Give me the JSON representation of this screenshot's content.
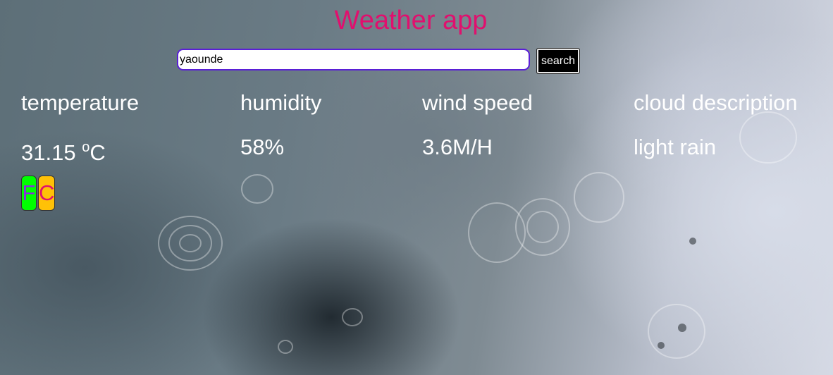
{
  "app": {
    "title": "Weather app"
  },
  "search": {
    "value": "yaounde",
    "button_label": "search"
  },
  "metrics": {
    "temperature": {
      "label": "temperature",
      "value": "31.15",
      "unit_super": "o",
      "unit": "C"
    },
    "humidity": {
      "label": "humidity",
      "value": "58%"
    },
    "wind_speed": {
      "label": "wind speed",
      "value": "3.6M/H"
    },
    "cloud": {
      "label": "cloud description",
      "value": "light rain"
    }
  },
  "units": {
    "fahrenheit_label": "F",
    "celsius_label": "C"
  },
  "colors": {
    "title": "#e0106e",
    "search_border": "#5a1fd6",
    "fahrenheit_bg": "#00ff00",
    "celsius_bg": "#ffc107"
  },
  "background": {
    "icon": "rain-water-ripples-photo"
  }
}
